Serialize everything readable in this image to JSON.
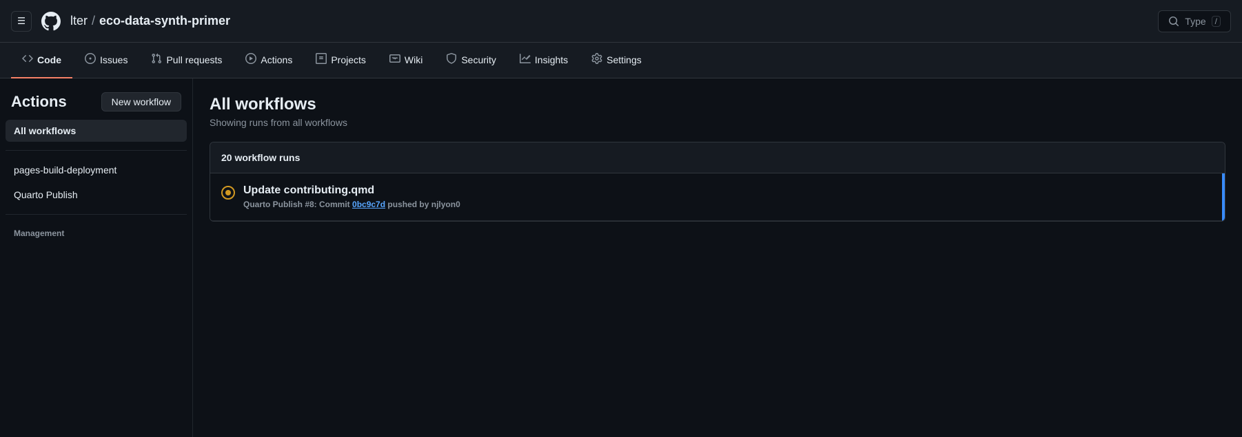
{
  "topbar": {
    "owner": "lter",
    "separator": "/",
    "repo": "eco-data-synth-primer",
    "search_label": "Type",
    "search_shortcut": "/",
    "hamburger_icon": "☰"
  },
  "tabs": [
    {
      "id": "code",
      "label": "Code",
      "icon": "code",
      "active": true
    },
    {
      "id": "issues",
      "label": "Issues",
      "icon": "circle-dot",
      "active": false
    },
    {
      "id": "pull-requests",
      "label": "Pull requests",
      "icon": "git-pull-request",
      "active": false
    },
    {
      "id": "actions",
      "label": "Actions",
      "icon": "play-circle",
      "active": false
    },
    {
      "id": "projects",
      "label": "Projects",
      "icon": "table",
      "active": false
    },
    {
      "id": "wiki",
      "label": "Wiki",
      "icon": "book",
      "active": false
    },
    {
      "id": "security",
      "label": "Security",
      "icon": "shield",
      "active": false
    },
    {
      "id": "insights",
      "label": "Insights",
      "icon": "graph",
      "active": false
    },
    {
      "id": "settings",
      "label": "Settings",
      "icon": "gear",
      "active": false
    }
  ],
  "sidebar": {
    "title": "Actions",
    "new_workflow_label": "New workflow",
    "active_item": "All workflows",
    "items": [
      {
        "id": "all-workflows",
        "label": "All workflows",
        "active": true
      },
      {
        "id": "pages-build-deployment",
        "label": "pages-build-deployment",
        "active": false
      },
      {
        "id": "quarto-publish",
        "label": "Quarto Publish",
        "active": false
      }
    ],
    "management_label": "Management"
  },
  "main": {
    "title": "All workflows",
    "subtitle": "Showing runs from all workflows",
    "runs_count_label": "20 workflow runs",
    "run_item": {
      "title": "Update contributing.qmd",
      "meta_prefix": "Quarto Publish #8: Commit",
      "commit_hash": "0bc9c7d",
      "meta_suffix": "pushed by njlyon0",
      "status": "in-progress"
    }
  },
  "colors": {
    "accent_red": "#f78166",
    "accent_blue": "#388bfd",
    "accent_yellow": "#d29922",
    "bg_dark": "#0d1117",
    "bg_medium": "#161b22",
    "border": "#30363d"
  }
}
